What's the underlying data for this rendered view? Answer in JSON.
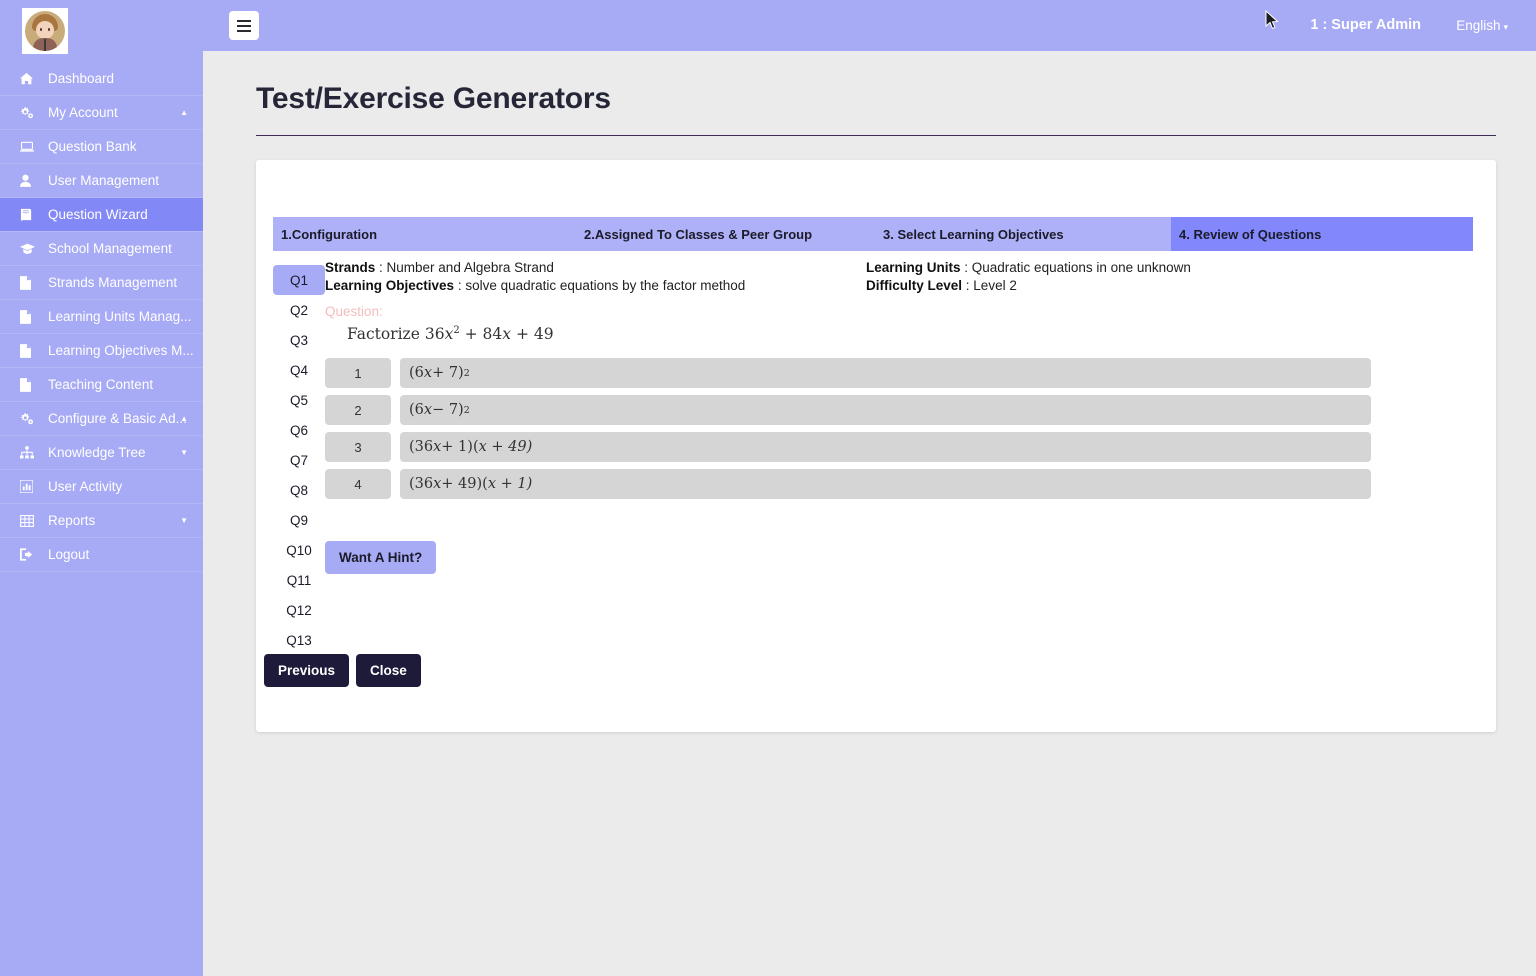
{
  "colors": {
    "sidebar_bg": "#a7aaf5",
    "sidebar_active": "#8288f5",
    "topbar_bg": "#a7aaf5",
    "page_bg": "#ebebeb",
    "tab_inactive": "#aeb1f7",
    "tab_active": "#8288fc",
    "option_bg": "#d5d5d5",
    "button_dark": "#1e1b3a",
    "question_label": "#f6bcbc"
  },
  "sidebar": {
    "avatar_alt": "user-avatar",
    "items": [
      {
        "label": "Dashboard",
        "icon": "home-icon",
        "active": false,
        "caret": ""
      },
      {
        "label": "My Account",
        "icon": "gears-icon",
        "active": false,
        "caret": "▲"
      },
      {
        "label": "Question Bank",
        "icon": "laptop-icon",
        "active": false,
        "caret": ""
      },
      {
        "label": "User Management",
        "icon": "user-icon",
        "active": false,
        "caret": ""
      },
      {
        "label": "Question Wizard",
        "icon": "book-icon",
        "active": true,
        "caret": ""
      },
      {
        "label": "School Management",
        "icon": "graduation-cap-icon",
        "active": false,
        "caret": ""
      },
      {
        "label": "Strands Management",
        "icon": "file-icon",
        "active": false,
        "caret": ""
      },
      {
        "label": "Learning Units Manag...",
        "icon": "file-icon",
        "active": false,
        "caret": ""
      },
      {
        "label": "Learning Objectives M...",
        "icon": "file-icon",
        "active": false,
        "caret": ""
      },
      {
        "label": "Teaching Content",
        "icon": "file-icon",
        "active": false,
        "caret": ""
      },
      {
        "label": "Configure & Basic Ad...",
        "icon": "gears-icon",
        "active": false,
        "caret": "▲"
      },
      {
        "label": "Knowledge Tree",
        "icon": "sitemap-icon",
        "active": false,
        "caret": "▼"
      },
      {
        "label": "User Activity",
        "icon": "bar-chart-icon",
        "active": false,
        "caret": ""
      },
      {
        "label": "Reports",
        "icon": "table-icon",
        "active": false,
        "caret": "▼"
      },
      {
        "label": "Logout",
        "icon": "sign-out-icon",
        "active": false,
        "caret": ""
      }
    ]
  },
  "topbar": {
    "menu_toggle": "hamburger-icon",
    "user": "1 : Super Admin",
    "language": "English",
    "language_caret": "▾"
  },
  "page": {
    "title": "Test/Exercise Generators"
  },
  "tabs": [
    {
      "label": "1.Configuration",
      "active": false
    },
    {
      "label": "2.Assigned To Classes & Peer Group",
      "active": false
    },
    {
      "label": "3. Select Learning Objectives",
      "active": false
    },
    {
      "label": "4. Review of Questions",
      "active": true
    }
  ],
  "question_nav": {
    "items": [
      "Q1",
      "Q2",
      "Q3",
      "Q4",
      "Q5",
      "Q6",
      "Q7",
      "Q8",
      "Q9",
      "Q10",
      "Q11",
      "Q12",
      "Q13"
    ],
    "active": "Q1"
  },
  "question": {
    "meta": {
      "strands_label": "Strands",
      "strands_value": ": Number and Algebra Strand",
      "learning_units_label": "Learning Units",
      "learning_units_value": ": Quadratic equations in one unknown",
      "learning_objectives_label": "Learning Objectives",
      "learning_objectives_value": ": solve quadratic equations by the factor method",
      "difficulty_label": "Difficulty Level",
      "difficulty_value": ": Level 2"
    },
    "question_heading": "Question:",
    "prompt_prefix": "Factorize ",
    "prompt_math": {
      "c1": "36",
      "v1": "x",
      "p1": "2",
      "op1": " + ",
      "c2": "84",
      "v2": "x",
      "op2": " + ",
      "c3": "49"
    },
    "options": [
      {
        "number": "1",
        "text_parts": {
          "open": "(6",
          "var": "x",
          "mid": " + 7)",
          "sup": "2",
          "tail": ""
        }
      },
      {
        "number": "2",
        "text_parts": {
          "open": "(6",
          "var": "x",
          "mid": " − 7)",
          "sup": "2",
          "tail": ""
        }
      },
      {
        "number": "3",
        "text_parts": {
          "open": "(36",
          "var": "x",
          "mid": " + 1)(",
          "sup": "",
          "tail": "x + 49)"
        }
      },
      {
        "number": "4",
        "text_parts": {
          "open": "(36",
          "var": "x",
          "mid": " + 49)(",
          "sup": "",
          "tail": "x + 1)"
        }
      }
    ],
    "hint_button": "Want A Hint?"
  },
  "footer": {
    "previous": "Previous",
    "close": "Close"
  }
}
